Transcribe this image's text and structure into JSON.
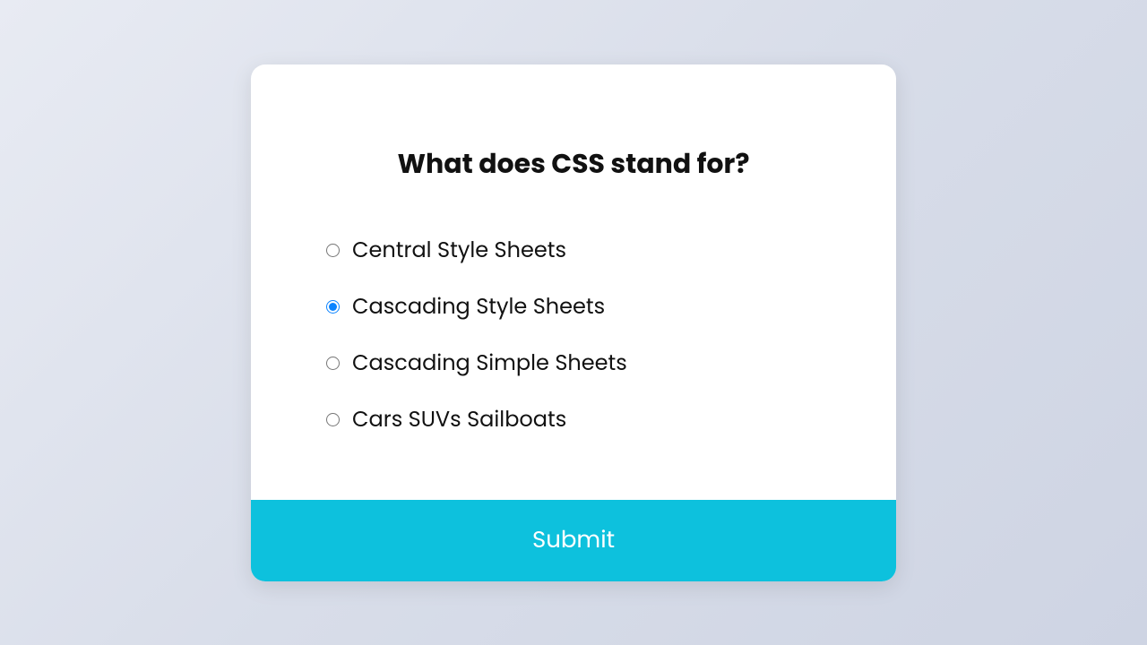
{
  "quiz": {
    "question": "What does CSS stand for?",
    "options": [
      {
        "label": "Central Style Sheets",
        "selected": false
      },
      {
        "label": "Cascading Style Sheets",
        "selected": true
      },
      {
        "label": "Cascading Simple Sheets",
        "selected": false
      },
      {
        "label": "Cars SUVs Sailboats",
        "selected": false
      }
    ],
    "submit_label": "Submit"
  },
  "colors": {
    "accent": "#0dc1dd",
    "radio_accent": "#0b84ff"
  }
}
